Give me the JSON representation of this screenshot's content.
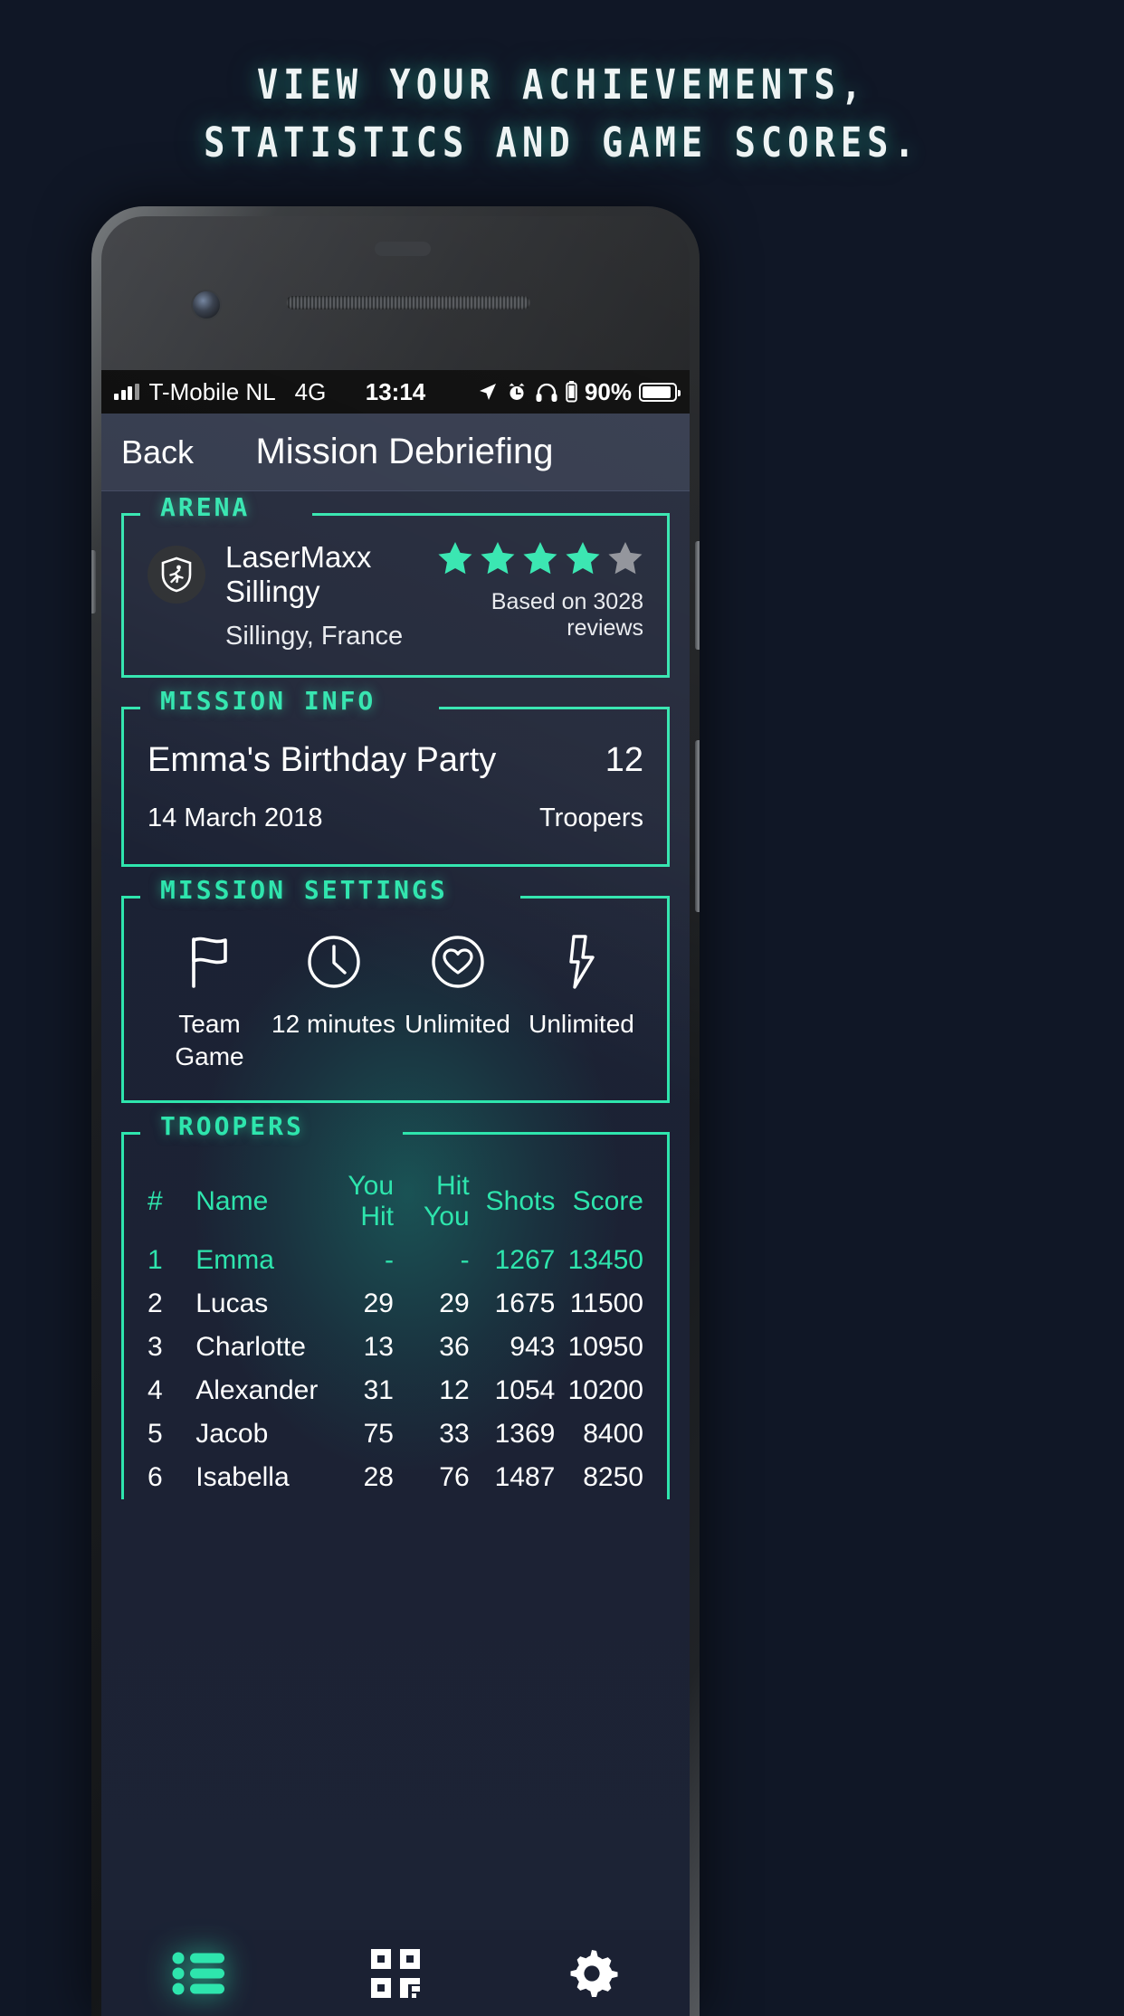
{
  "promo": {
    "line1": "VIEW YOUR ACHIEVEMENTS,",
    "line2": "STATISTICS AND GAME SCORES."
  },
  "colors": {
    "accent": "#2ee5ad",
    "page_bg": "#101726",
    "screen_bg": "#1b2133",
    "navbar_bg": "#2b3245",
    "star_empty": "#8c8f96"
  },
  "status_bar": {
    "carrier": "T-Mobile NL",
    "network": "4G",
    "time": "13:14",
    "battery_percent": "90%",
    "icons": [
      "signal-icon",
      "location-arrow-icon",
      "alarm-clock-icon",
      "headphones-icon",
      "device-battery-icon",
      "battery-icon"
    ]
  },
  "navbar": {
    "back_label": "Back",
    "title": "Mission Debriefing"
  },
  "arena": {
    "legend": "ARENA",
    "badge_icon": "arena-shield-runner-icon",
    "name": "LaserMaxx Sillingy",
    "location": "Sillingy, France",
    "rating": 4,
    "max_rating": 5,
    "reviews_text": "Based on 3028 reviews"
  },
  "mission_info": {
    "legend": "MISSION INFO",
    "title": "Emma's Birthday Party",
    "date": "14 March 2018",
    "count": "12",
    "count_label": "Troopers"
  },
  "mission_settings": {
    "legend": "MISSION SETTINGS",
    "items": [
      {
        "icon": "flag-icon",
        "label": "Team\nGame",
        "line1": "Team",
        "line2": "Game"
      },
      {
        "icon": "clock-icon",
        "label": "12 minutes",
        "line1": "12 minutes",
        "line2": ""
      },
      {
        "icon": "heart-icon",
        "label": "Unlimited",
        "line1": "Unlimited",
        "line2": ""
      },
      {
        "icon": "lightning-icon",
        "label": "Unlimited",
        "line1": "Unlimited",
        "line2": ""
      }
    ]
  },
  "troopers": {
    "legend": "TROOPERS",
    "columns": [
      "#",
      "Name",
      "You Hit",
      "Hit You",
      "Shots",
      "Score"
    ],
    "rows": [
      {
        "rank": "1",
        "name": "Emma",
        "you_hit": "-",
        "hit_you": "-",
        "shots": "1267",
        "score": "13450",
        "highlight": true
      },
      {
        "rank": "2",
        "name": "Lucas",
        "you_hit": "29",
        "hit_you": "29",
        "shots": "1675",
        "score": "11500",
        "highlight": false
      },
      {
        "rank": "3",
        "name": "Charlotte",
        "you_hit": "13",
        "hit_you": "36",
        "shots": "943",
        "score": "10950",
        "highlight": false
      },
      {
        "rank": "4",
        "name": "Alexander",
        "you_hit": "31",
        "hit_you": "12",
        "shots": "1054",
        "score": "10200",
        "highlight": false
      },
      {
        "rank": "5",
        "name": "Jacob",
        "you_hit": "75",
        "hit_you": "33",
        "shots": "1369",
        "score": "8400",
        "highlight": false
      },
      {
        "rank": "6",
        "name": "Isabella",
        "you_hit": "28",
        "hit_you": "76",
        "shots": "1487",
        "score": "8250",
        "highlight": false
      }
    ]
  },
  "tabbar": {
    "tabs": [
      {
        "icon": "list-icon",
        "name": "tab-list",
        "active": true
      },
      {
        "icon": "qr-code-icon",
        "name": "tab-qr-code",
        "active": false
      },
      {
        "icon": "gear-icon",
        "name": "tab-settings",
        "active": false
      }
    ]
  }
}
